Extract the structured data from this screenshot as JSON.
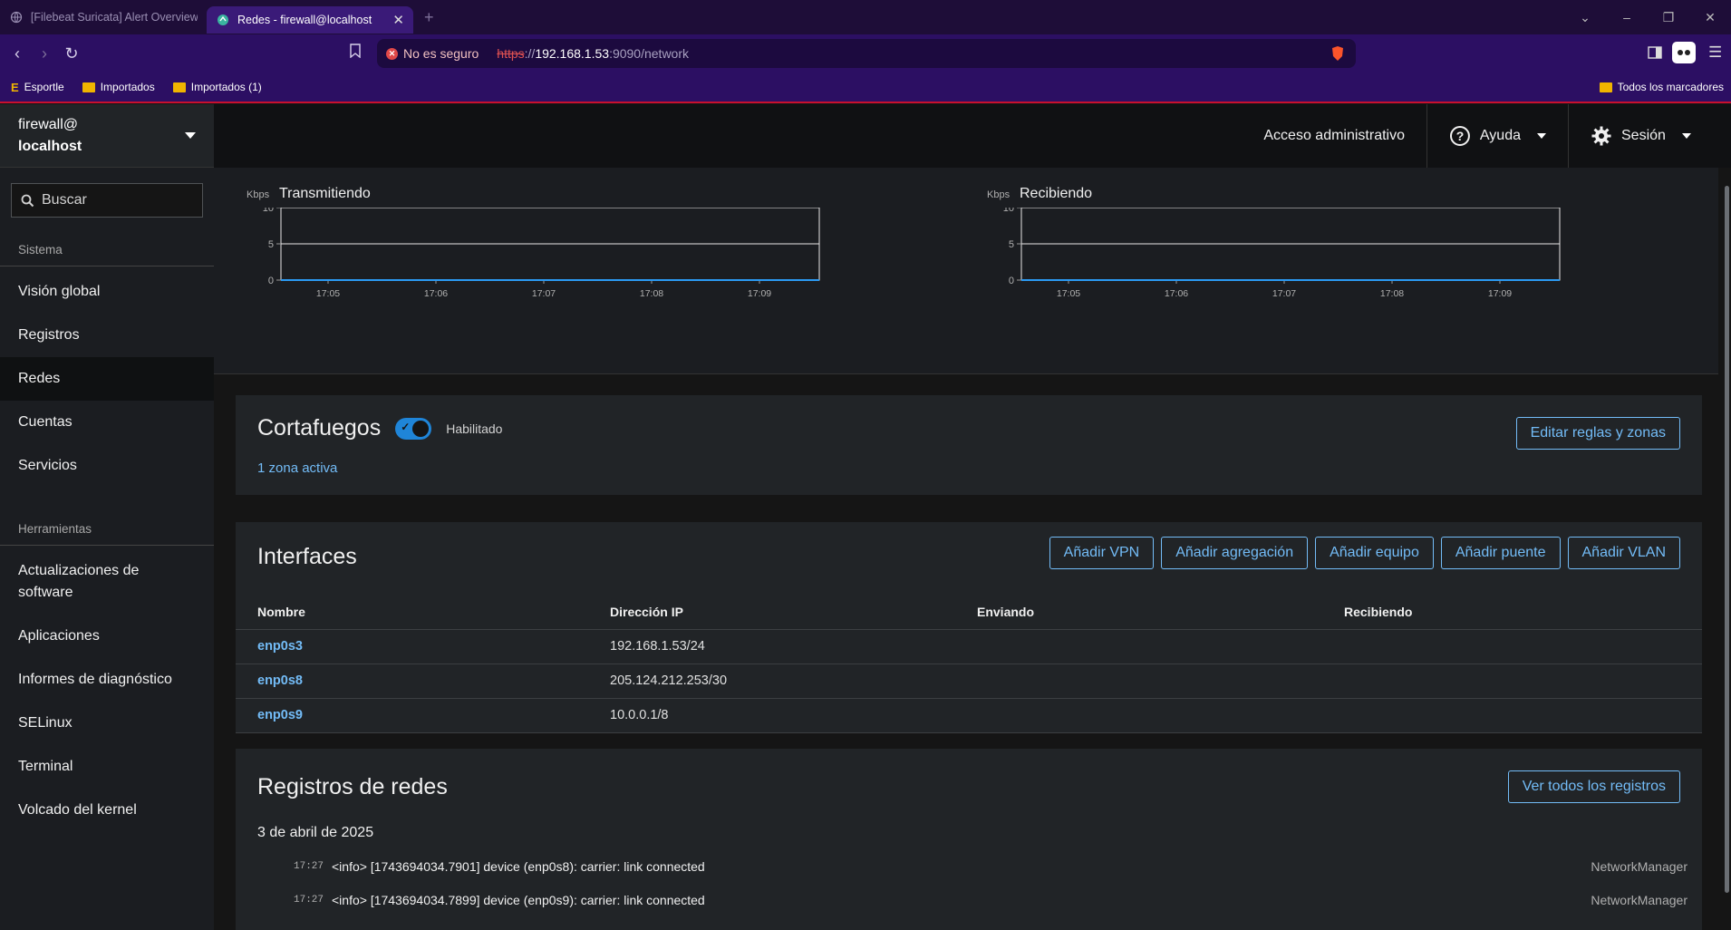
{
  "browser": {
    "tabs": [
      {
        "title": "[Filebeat Suricata] Alert Overview - E",
        "active": false
      },
      {
        "title": "Redes - firewall@localhost",
        "active": true
      }
    ],
    "security_label": "No es seguro",
    "url": {
      "scheme": "https",
      "sep": "://",
      "host": "192.168.1.53",
      "path": ":9090/network"
    },
    "bookmarks": [
      "Esportle",
      "Importados",
      "Importados (1)"
    ],
    "all_bookmarks": "Todos los marcadores"
  },
  "host": {
    "user": "firewall@",
    "name": "localhost"
  },
  "search": {
    "placeholder": "Buscar"
  },
  "sidebar": {
    "system_label": "Sistema",
    "system_items": [
      "Visión global",
      "Registros",
      "Redes",
      "Cuentas",
      "Servicios"
    ],
    "active_item": "Redes",
    "tools_label": "Herramientas",
    "tools_items": [
      "Actualizaciones de software",
      "Aplicaciones",
      "Informes de diagnóstico",
      "SELinux",
      "Terminal",
      "Volcado del kernel"
    ]
  },
  "topnav": {
    "admin": "Acceso administrativo",
    "help": "Ayuda",
    "session": "Sesión"
  },
  "chart_data": [
    {
      "type": "line",
      "title": "Transmitiendo",
      "ylabel": "Kbps",
      "x": [
        "17:05",
        "17:06",
        "17:07",
        "17:08",
        "17:09"
      ],
      "ylim": [
        0,
        10
      ],
      "yticks": [
        "0",
        "5",
        "10"
      ],
      "series": [
        {
          "values": [
            0,
            0,
            0,
            0,
            0
          ]
        }
      ],
      "grid": true
    },
    {
      "type": "line",
      "title": "Recibiendo",
      "ylabel": "Kbps",
      "x": [
        "17:05",
        "17:06",
        "17:07",
        "17:08",
        "17:09"
      ],
      "ylim": [
        0,
        10
      ],
      "yticks": [
        "0",
        "5",
        "10"
      ],
      "series": [
        {
          "values": [
            0,
            0,
            0,
            0,
            0
          ]
        }
      ],
      "grid": true
    }
  ],
  "firewall": {
    "title": "Cortafuegos",
    "status": "Habilitado",
    "enabled": true,
    "zones": "1 zona activa",
    "edit_button": "Editar reglas y zonas"
  },
  "interfaces": {
    "title": "Interfaces",
    "buttons": [
      "Añadir VPN",
      "Añadir agregación",
      "Añadir equipo",
      "Añadir puente",
      "Añadir VLAN"
    ],
    "columns": [
      "Nombre",
      "Dirección IP",
      "Enviando",
      "Recibiendo"
    ],
    "rows": [
      {
        "name": "enp0s3",
        "ip": "192.168.1.53/24",
        "sending": "",
        "receiving": ""
      },
      {
        "name": "enp0s8",
        "ip": "205.124.212.253/30",
        "sending": "",
        "receiving": ""
      },
      {
        "name": "enp0s9",
        "ip": "10.0.0.1/8",
        "sending": "",
        "receiving": ""
      }
    ]
  },
  "logs": {
    "title": "Registros de redes",
    "button": "Ver todos los registros",
    "date": "3 de abril de 2025",
    "entries": [
      {
        "time": "17:27",
        "message": "<info> [1743694034.7901] device (enp0s8): carrier: link connected",
        "source": "NetworkManager"
      },
      {
        "time": "17:27",
        "message": "<info> [1743694034.7899] device (enp0s9): carrier: link connected",
        "source": "NetworkManager"
      }
    ]
  },
  "colors": {
    "accent": "#73bcf7",
    "toggle": "#1f85d8",
    "browser_purple": "#2c0f63",
    "line": "#2b9af3"
  }
}
